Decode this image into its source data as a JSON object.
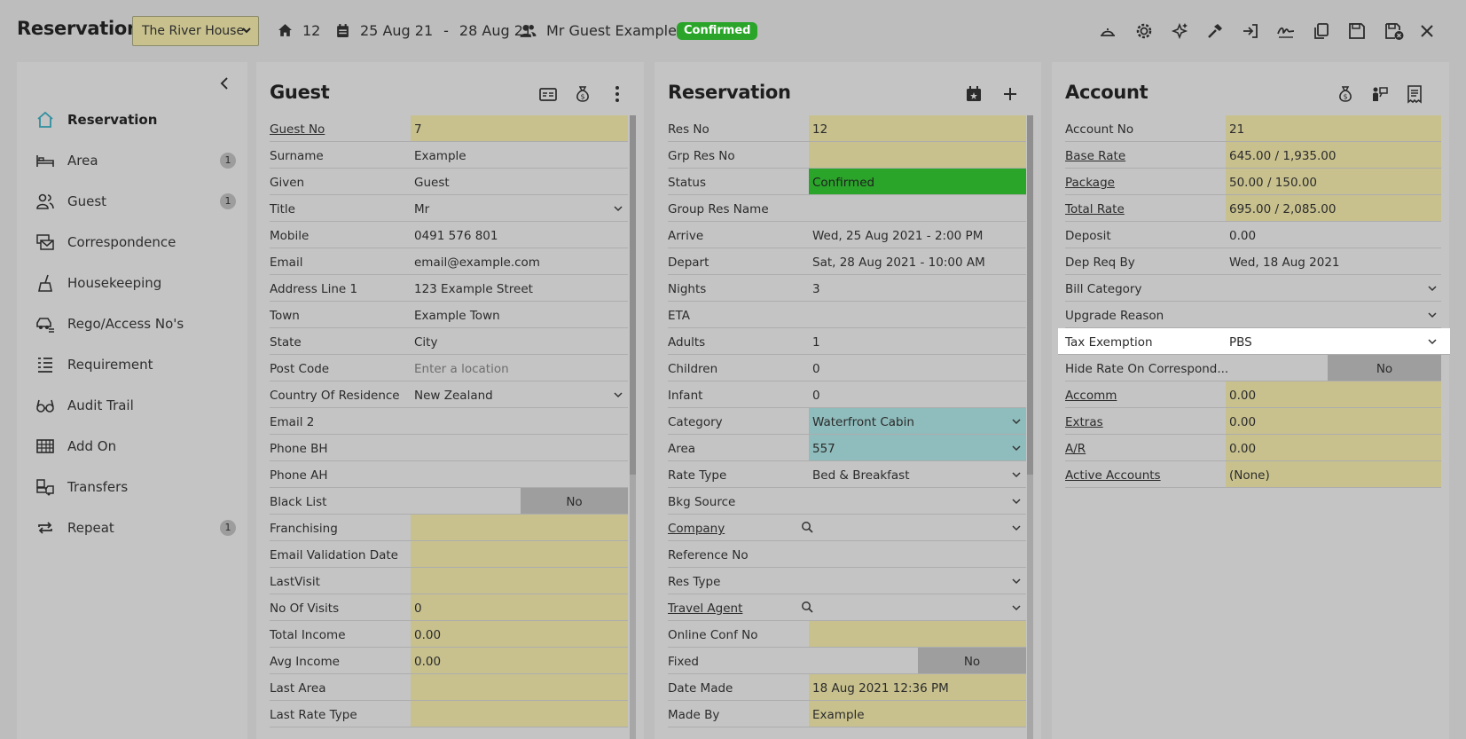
{
  "header": {
    "title": "Reservation",
    "property": "The River House",
    "area_no": "12",
    "arrive": "25 Aug 21",
    "date_sep": "-",
    "depart": "28 Aug 21",
    "guest": "Mr Guest Example",
    "status": "Confirmed",
    "toolbar_icons": [
      "bell-service-icon",
      "gear-icon",
      "sparkle-icon",
      "hammer-icon",
      "sign-in-icon",
      "signature-icon",
      "copy-icon",
      "save-icon",
      "save-close-icon",
      "close-icon"
    ]
  },
  "colors": {
    "yellow": "#c8c18e",
    "green": "#2aa52a",
    "teal": "#8fbcbc",
    "bg": "#bdbdbd",
    "panel": "#c4c4c4"
  },
  "sidebar": {
    "items": [
      {
        "label": "Reservation",
        "icon": "home-icon",
        "count": ""
      },
      {
        "label": "Area",
        "icon": "bed-icon",
        "count": "1"
      },
      {
        "label": "Guest",
        "icon": "users-icon",
        "count": "1"
      },
      {
        "label": "Correspondence",
        "icon": "mail-stack-icon",
        "count": ""
      },
      {
        "label": "Housekeeping",
        "icon": "broom-icon",
        "count": ""
      },
      {
        "label": "Rego/Access No's",
        "icon": "car-icon",
        "count": ""
      },
      {
        "label": "Requirement",
        "icon": "list-icon",
        "count": ""
      },
      {
        "label": "Audit Trail",
        "icon": "glasses-icon",
        "count": ""
      },
      {
        "label": "Add On",
        "icon": "grid-icon",
        "count": ""
      },
      {
        "label": "Transfers",
        "icon": "transfer-icon",
        "count": ""
      },
      {
        "label": "Repeat",
        "icon": "repeat-icon",
        "count": "1"
      }
    ]
  },
  "guest": {
    "title": "Guest",
    "rows": [
      {
        "label": "Guest No",
        "value": "7"
      },
      {
        "label": "Surname",
        "value": "Example"
      },
      {
        "label": "Given",
        "value": "Guest"
      },
      {
        "label": "Title",
        "value": "Mr"
      },
      {
        "label": "Mobile",
        "value": "0491 576 801"
      },
      {
        "label": "Email",
        "value": "email@example.com"
      },
      {
        "label": "Address Line 1",
        "value": "123 Example Street"
      },
      {
        "label": "Town",
        "value": "Example Town"
      },
      {
        "label": "State",
        "value": "City"
      },
      {
        "label": "Post Code",
        "value": "Enter a location"
      },
      {
        "label": "Country Of Residence",
        "value": "New Zealand"
      },
      {
        "label": "Email 2",
        "value": ""
      },
      {
        "label": "Phone BH",
        "value": ""
      },
      {
        "label": "Phone AH",
        "value": ""
      },
      {
        "label": "Black List",
        "value": "No"
      },
      {
        "label": "Franchising",
        "value": ""
      },
      {
        "label": "Email Validation Date",
        "value": ""
      },
      {
        "label": "LastVisit",
        "value": ""
      },
      {
        "label": "No Of Visits",
        "value": "0"
      },
      {
        "label": "Total Income",
        "value": "0.00"
      },
      {
        "label": "Avg Income",
        "value": "0.00"
      },
      {
        "label": "Last Area",
        "value": ""
      },
      {
        "label": "Last Rate Type",
        "value": ""
      }
    ]
  },
  "reservation": {
    "title": "Reservation",
    "rows": [
      {
        "label": "Res No",
        "value": "12"
      },
      {
        "label": "Grp Res No",
        "value": ""
      },
      {
        "label": "Status",
        "value": "Confirmed"
      },
      {
        "label": "Group Res Name",
        "value": ""
      },
      {
        "label": "Arrive",
        "value": "Wed, 25 Aug 2021 - 2:00 PM"
      },
      {
        "label": "Depart",
        "value": "Sat, 28 Aug 2021 - 10:00 AM"
      },
      {
        "label": "Nights",
        "value": "3"
      },
      {
        "label": "ETA",
        "value": ""
      },
      {
        "label": "Adults",
        "value": "1"
      },
      {
        "label": "Children",
        "value": "0"
      },
      {
        "label": "Infant",
        "value": "0"
      },
      {
        "label": "Category",
        "value": "Waterfront Cabin"
      },
      {
        "label": "Area",
        "value": "557"
      },
      {
        "label": "Rate Type",
        "value": "Bed & Breakfast"
      },
      {
        "label": "Bkg Source",
        "value": ""
      },
      {
        "label": "Company",
        "value": ""
      },
      {
        "label": "Reference No",
        "value": ""
      },
      {
        "label": "Res Type",
        "value": ""
      },
      {
        "label": "Travel Agent",
        "value": ""
      },
      {
        "label": "Online Conf No",
        "value": ""
      },
      {
        "label": "Fixed",
        "value": "No"
      },
      {
        "label": "Date Made",
        "value": "18 Aug 2021 12:36 PM"
      },
      {
        "label": "Made By",
        "value": "Example"
      }
    ]
  },
  "account": {
    "title": "Account",
    "rows": [
      {
        "label": "Account No",
        "value": "21"
      },
      {
        "label": "Base Rate",
        "value": "645.00 / 1,935.00"
      },
      {
        "label": "Package",
        "value": "50.00 / 150.00"
      },
      {
        "label": "Total Rate",
        "value": "695.00 / 2,085.00"
      },
      {
        "label": "Deposit",
        "value": "0.00"
      },
      {
        "label": "Dep Req By",
        "value": "Wed, 18 Aug 2021"
      },
      {
        "label": "Bill Category",
        "value": ""
      },
      {
        "label": "Upgrade Reason",
        "value": ""
      },
      {
        "label": "Tax Exemption",
        "value": "PBS"
      },
      {
        "label": "Hide Rate On Correspond...",
        "value": "No"
      },
      {
        "label": "Accomm",
        "value": "0.00"
      },
      {
        "label": "Extras",
        "value": "0.00"
      },
      {
        "label": "A/R",
        "value": "0.00"
      },
      {
        "label": "Active Accounts",
        "value": "(None)"
      }
    ]
  }
}
